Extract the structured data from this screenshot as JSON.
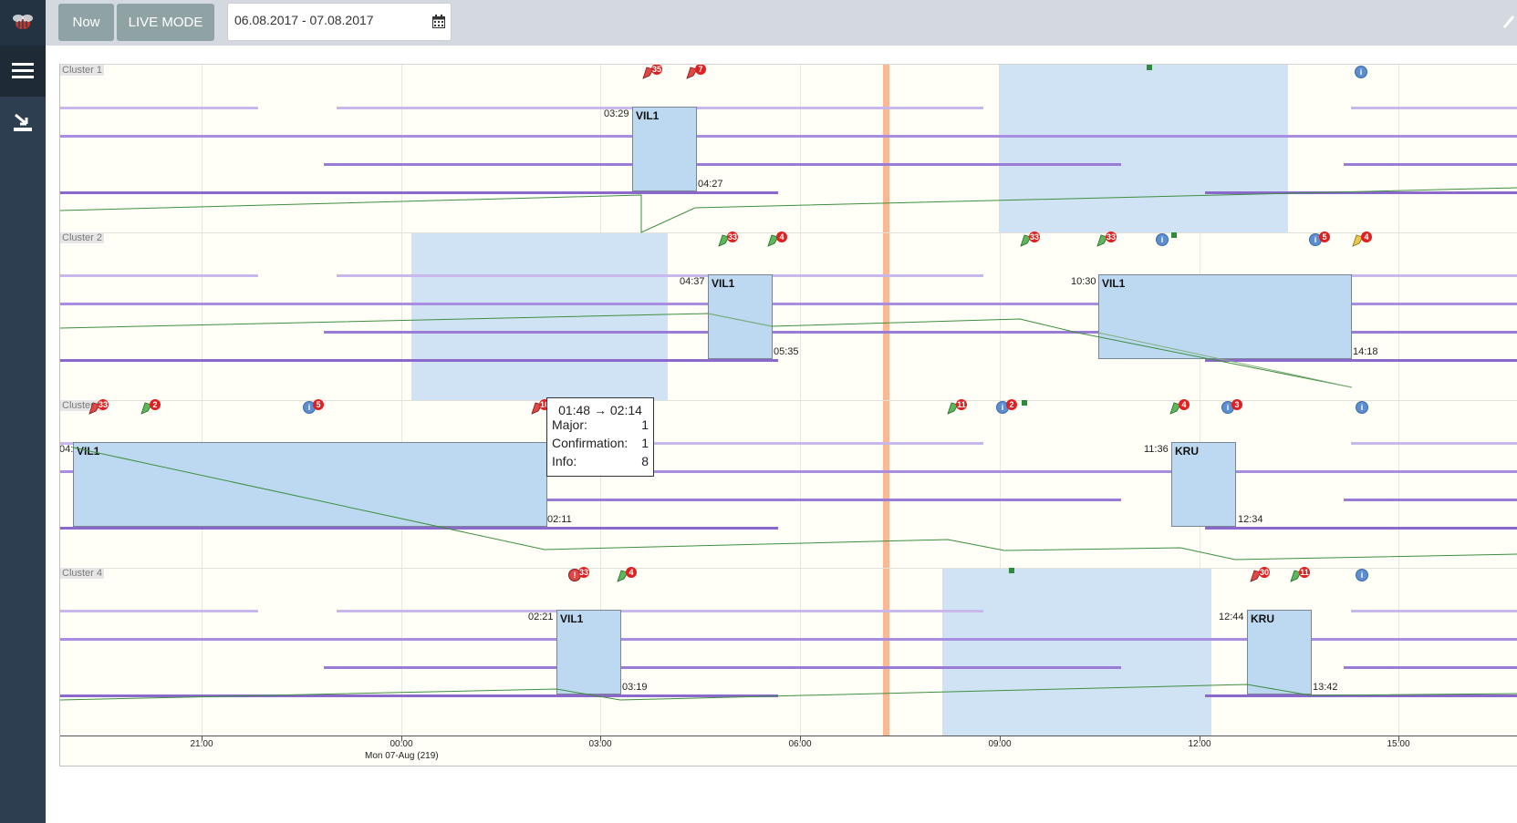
{
  "toolbar": {
    "now_label": "Now",
    "live_label": "LIVE MODE",
    "date_range": "06.08.2017 - 07.08.2017"
  },
  "clusters": [
    {
      "label": "Cluster 1"
    },
    {
      "label": "Cluster 2"
    },
    {
      "label": "Cluster 3"
    },
    {
      "label": "Cluster 4"
    }
  ],
  "boxes": [
    {
      "name": "VIL1",
      "start": "03:29",
      "end": "04:27"
    },
    {
      "name": "VIL1",
      "start": "04:37",
      "end": "05:35"
    },
    {
      "name": "VIL1",
      "start": "10:30",
      "end": "14:18"
    },
    {
      "name": "VIL1",
      "start": "04:",
      "end": "02:11"
    },
    {
      "name": "KRU",
      "start": "11:36",
      "end": "12:34"
    },
    {
      "name": "VIL1",
      "start": "02:21",
      "end": "03:19"
    },
    {
      "name": "KRU",
      "start": "12:44",
      "end": "13:42"
    }
  ],
  "badges": [
    "35",
    "7",
    "33",
    "4",
    "33",
    "33",
    "5",
    "4",
    "33",
    "2",
    "5",
    "10",
    "11",
    "2",
    "4",
    "3",
    "33",
    "4",
    "30",
    "11"
  ],
  "tooltip": {
    "title": "01:48 → 02:14",
    "rows": [
      {
        "label": "Major:",
        "value": "1"
      },
      {
        "label": "Confirmation:",
        "value": "1"
      },
      {
        "label": "Info:",
        "value": "8"
      }
    ]
  },
  "axis": {
    "ticks": [
      "21:00",
      "00:00",
      "03:00",
      "06:00",
      "09:00",
      "12:00",
      "15:00"
    ],
    "sublabel": "Mon 07-Aug (219)"
  },
  "colors": {
    "sidebar": "#2c3e50",
    "topbar": "#d3d9df",
    "button": "#8fa3a4",
    "band": "#cfe3f5",
    "box": "#bcd9f1",
    "now_line": "#fbb894",
    "purple_line": "#9370db",
    "green_line": "#2e8b3b",
    "badge_red": "#e02020"
  },
  "icons": {
    "logo": "bee-logo-icon",
    "menu": "hamburger-menu-icon",
    "import": "import-arrow-icon",
    "calendar": "calendar-icon",
    "pencil": "pencil-icon",
    "alarm": "flag-alarm-icon",
    "info": "info-icon"
  }
}
